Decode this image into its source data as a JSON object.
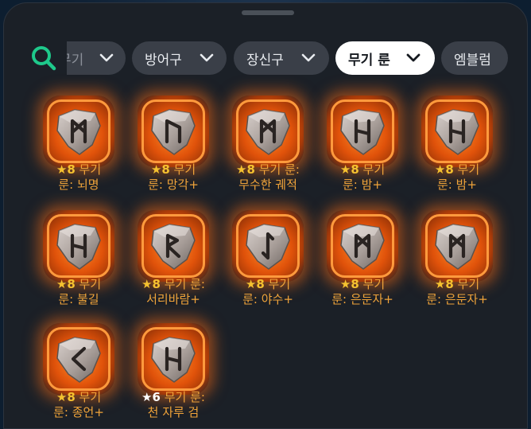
{
  "filters": [
    {
      "label": "무기",
      "chevron": true,
      "active": false
    },
    {
      "label": "방어구",
      "chevron": true,
      "active": false
    },
    {
      "label": "장신구",
      "chevron": true,
      "active": false
    },
    {
      "label": "무기 룬",
      "chevron": true,
      "active": true
    },
    {
      "label": "엠블럼",
      "chevron": false,
      "active": false
    }
  ],
  "items": [
    {
      "star": "★",
      "level": "8",
      "line1": " 무기",
      "line2": "룬: 뇌명",
      "rune": "mannaz"
    },
    {
      "star": "★",
      "level": "8",
      "line1": " 무기",
      "line2": "룬: 망각+",
      "rune": "uruz"
    },
    {
      "star": "★",
      "level": "8",
      "line1": " 무기 룬:",
      "line2": "무수한 궤적",
      "rune": "mannaz"
    },
    {
      "star": "★",
      "level": "8",
      "line1": " 무기",
      "line2": "룬: 밤+",
      "rune": "hagalaz"
    },
    {
      "star": "★",
      "level": "8",
      "line1": " 무기",
      "line2": "룬: 밤+",
      "rune": "hagalaz"
    },
    {
      "star": "★",
      "level": "8",
      "line1": " 무기",
      "line2": "룬: 불길",
      "rune": "hagalaz"
    },
    {
      "star": "★",
      "level": "8",
      "line1": " 무기 룬:",
      "line2": "서리바람+",
      "rune": "raidho"
    },
    {
      "star": "★",
      "level": "8",
      "line1": " 무기",
      "line2": "룬: 야수+",
      "rune": "eihwaz"
    },
    {
      "star": "★",
      "level": "8",
      "line1": " 무기",
      "line2": "룬: 은둔자+",
      "rune": "mannaz"
    },
    {
      "star": "★",
      "level": "8",
      "line1": " 무기",
      "line2": "룬: 은둔자+",
      "rune": "mannaz"
    },
    {
      "star": "★",
      "level": "8",
      "line1": " 무기",
      "line2": "룬: 종언+",
      "rune": "kaunan"
    },
    {
      "star": "★",
      "level": "6",
      "line1": " 무기 룬:",
      "line2": "천 자루 검",
      "rune": "hagalaz"
    }
  ],
  "colors": {
    "accent": "#1ec98b",
    "glow": "#ff7a1a",
    "caption": "#f0a43a",
    "star": "#f5c230"
  }
}
